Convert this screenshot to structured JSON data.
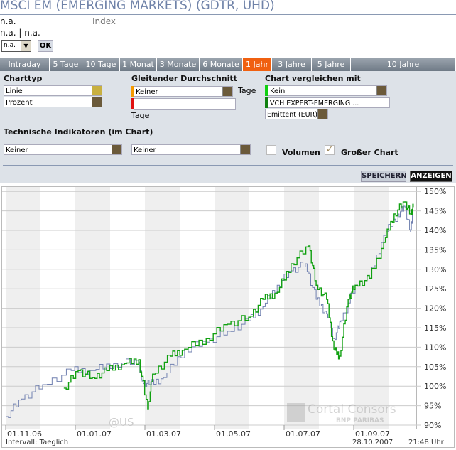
{
  "header": {
    "title": "MSCI EM (EMERGING MARKETS) (GDTR, UHD)",
    "price": "n.a.",
    "type": "Index",
    "change": "n.a. | n.a.",
    "exchange_select": "n.a.",
    "ok_label": "OK"
  },
  "tabs": [
    {
      "label": "Intraday"
    },
    {
      "label": "5 Tage"
    },
    {
      "label": "10 Tage"
    },
    {
      "label": "1 Monat"
    },
    {
      "label": "3 Monate"
    },
    {
      "label": "6 Monate"
    },
    {
      "label": "1 Jahr",
      "active": true
    },
    {
      "label": "3 Jahre"
    },
    {
      "label": "5 Jahre"
    },
    {
      "label": "10 Jahre"
    }
  ],
  "settings": {
    "charttyp_label": "Charttyp",
    "charttyp": "Linie",
    "scale": "Prozent",
    "gd_label": "Gleitender Durchschnitt",
    "gd1": "Keiner",
    "gd_unit": "Tage",
    "gd2": "",
    "gd2_unit": "Tage",
    "compare_label": "Chart vergleichen mit",
    "compare1": "Kein",
    "compare2": "VCH EXPERT-EMERGING ...",
    "compare_source": "Emittent (EUR)",
    "ti_label": "Technische Indikatoren (im Chart)",
    "ti1": "Keiner",
    "ti2": "Keiner",
    "volumen_label": "Volumen",
    "volumen_checked": false,
    "gross_label": "Großer Chart",
    "gross_checked": true,
    "save_label": "SPEICHERN",
    "show_label": "ANZEIGEN"
  },
  "colors": {
    "accent": "#f06010",
    "series_main": "#7080b0",
    "series_compare": "#10a010"
  },
  "chart_data": {
    "type": "line",
    "x_unit": "months since 01.11.06",
    "xticks": [
      "01.11.06",
      "01.01.07",
      "01.03.07",
      "01.05.07",
      "01.07.07",
      "01.09.07"
    ],
    "xtick_values": [
      0,
      2,
      4,
      6,
      8,
      10
    ],
    "yticks": [
      "90%",
      "95%",
      "100%",
      "105%",
      "110%",
      "115%",
      "120%",
      "125%",
      "130%",
      "135%",
      "140%",
      "145%",
      "150%"
    ],
    "ylim": [
      90,
      150
    ],
    "xlim": [
      0,
      11.8
    ],
    "series": [
      {
        "name": "MSCI EM (EMERGING MARKETS)",
        "x": [
          0,
          0.45,
          1.06,
          1.88,
          2.49,
          3.1,
          3.82,
          3.92,
          4.12,
          4.53,
          5.14,
          5.76,
          6.37,
          6.98,
          7.39,
          7.8,
          8.2,
          8.61,
          8.92,
          9.22,
          9.43,
          9.63,
          10.04,
          10.45,
          10.86,
          11.27,
          11.47,
          11.63,
          11.71
        ],
        "y": [
          92.2,
          96.7,
          100.4,
          104,
          104,
          105.8,
          106.2,
          101.3,
          100.4,
          102.2,
          109.5,
          111.3,
          114.1,
          116.8,
          120.4,
          125.9,
          129.6,
          131.4,
          122.3,
          118.6,
          112.2,
          116.8,
          125.9,
          127.7,
          138.7,
          144.2,
          146,
          139.6,
          146
        ]
      },
      {
        "name": "VCH EXPERT-EMERGING",
        "x": [
          1.67,
          2.08,
          2.49,
          2.9,
          3.41,
          3.82,
          4.08,
          4.22,
          4.73,
          5.14,
          5.76,
          6.37,
          6.98,
          7.39,
          7.8,
          8.2,
          8.71,
          8.92,
          9.22,
          9.43,
          9.59,
          9.84,
          10.04,
          10.45,
          10.86,
          11.16,
          11.47,
          11.63,
          11.71
        ],
        "y": [
          99.5,
          104,
          102.2,
          104,
          105.8,
          106.8,
          94,
          103.1,
          107.7,
          109.5,
          112.2,
          115.9,
          117.7,
          122.3,
          124.1,
          131.4,
          136,
          125.9,
          122.3,
          109.5,
          107.7,
          122.3,
          125.9,
          127.7,
          136.9,
          144.2,
          147.3,
          144.2,
          146
        ]
      }
    ],
    "watermark": "@US",
    "logo": "Cortal Consors BNP PARIBAS",
    "interval": "Intervall: Taeglich",
    "date": "28.10.2007",
    "time": "21:48 Uhr"
  }
}
